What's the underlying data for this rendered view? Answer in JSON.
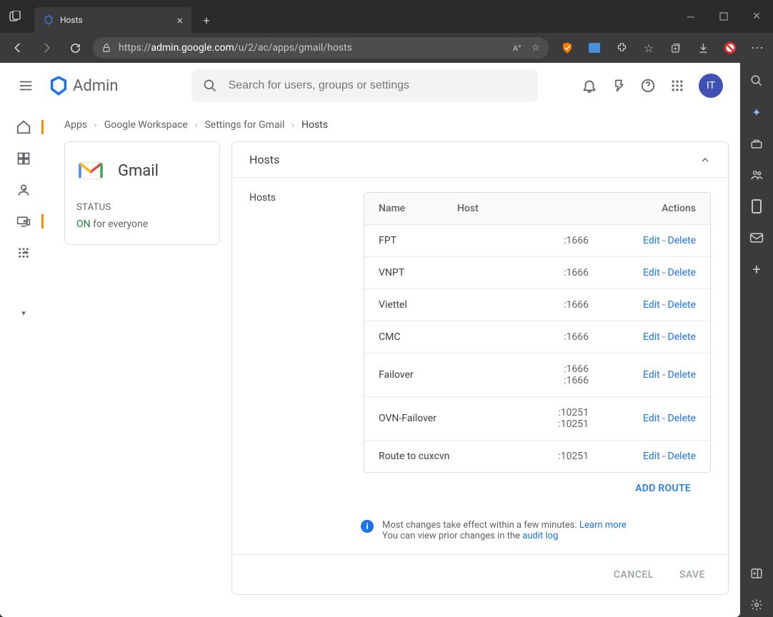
{
  "browser": {
    "tab_title": "Hosts",
    "url_prefix": "https://",
    "url_host": "admin.google.com",
    "url_path": "/u/2/ac/apps/gmail/hosts"
  },
  "header": {
    "brand": "Admin",
    "search_placeholder": "Search for users, groups or settings",
    "avatar": "IT"
  },
  "breadcrumb": [
    "Apps",
    "Google Workspace",
    "Settings for Gmail",
    "Hosts"
  ],
  "gmail_card": {
    "title": "Gmail",
    "status_label": "STATUS",
    "status_on": "ON",
    "status_text": " for everyone"
  },
  "hosts_panel": {
    "title": "Hosts",
    "section_label": "Hosts",
    "columns": {
      "name": "Name",
      "host": "Host",
      "actions": "Actions"
    },
    "edit": "Edit",
    "dash": " - ",
    "delete": "Delete",
    "rows": [
      {
        "name": "FPT",
        "hosts": [
          ":1666"
        ]
      },
      {
        "name": "VNPT",
        "hosts": [
          ":1666"
        ]
      },
      {
        "name": "Viettel",
        "hosts": [
          ":1666"
        ]
      },
      {
        "name": "CMC",
        "hosts": [
          ":1666"
        ]
      },
      {
        "name": "Failover",
        "hosts": [
          ":1666",
          ":1666"
        ]
      },
      {
        "name": "OVN-Failover",
        "hosts": [
          ":10251",
          ":10251"
        ]
      },
      {
        "name": "Route to cuxcvn",
        "hosts": [
          ":10251"
        ]
      }
    ],
    "add_route": "ADD ROUTE",
    "info_line1a": "Most changes take effect within a few minutes. ",
    "info_learn": "Learn more",
    "info_line2a": "You can view prior changes in the ",
    "info_audit": "audit log",
    "cancel": "CANCEL",
    "save": "SAVE"
  }
}
